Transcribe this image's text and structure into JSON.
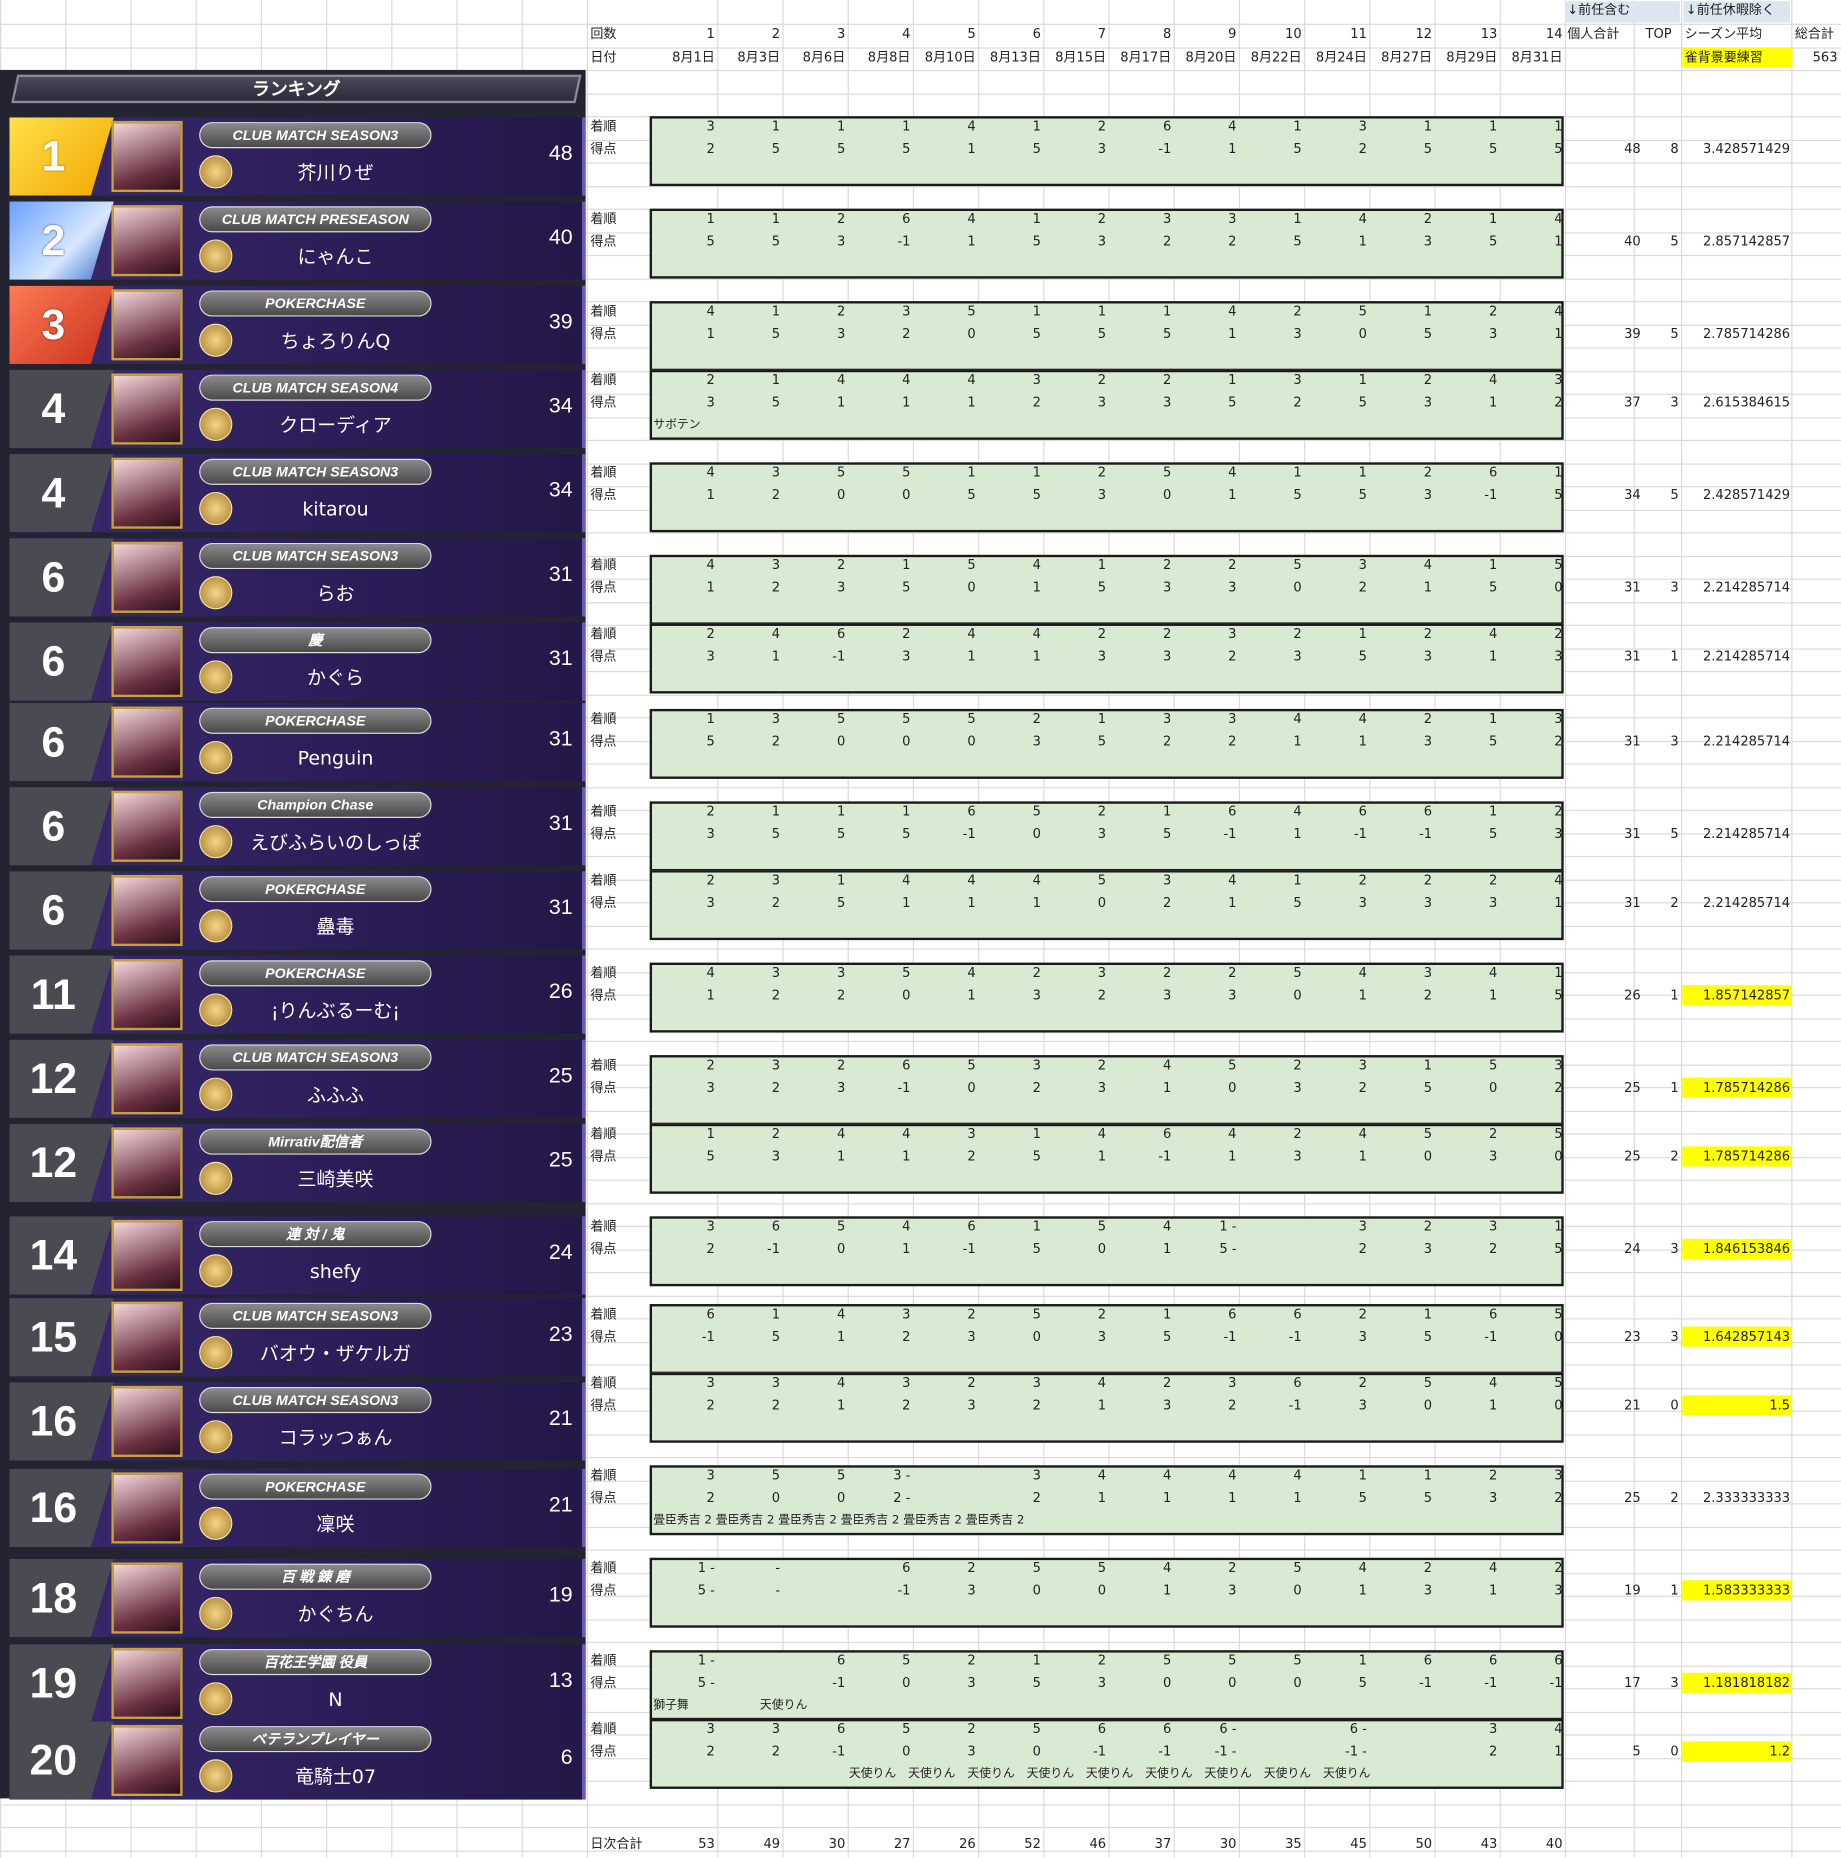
{
  "header": {
    "row1_label": "回数",
    "row2_label": "日付",
    "rounds": [
      "1",
      "2",
      "3",
      "4",
      "5",
      "6",
      "7",
      "8",
      "9",
      "10",
      "11",
      "12",
      "13",
      "14"
    ],
    "dates": [
      "8月1日",
      "8月3日",
      "8月6日",
      "8月8日",
      "8月10日",
      "8月13日",
      "8月15日",
      "8月17日",
      "8月20日",
      "8月22日",
      "8月24日",
      "8月27日",
      "8月29日",
      "8月31日"
    ],
    "note_incl": "↓前任含む",
    "note_excl": "↓前任休暇除く",
    "personal_total": "個人合計",
    "top": "TOP",
    "season_avg": "シーズン平均",
    "grand_total_label": "総合計",
    "grand_total_value": "563",
    "warning": "雀背景要練習"
  },
  "ranking_title": "ランキング",
  "row_labels": {
    "rank": "着順",
    "score": "得点"
  },
  "players": [
    {
      "rank": "1",
      "name": "芥川りぜ",
      "badge": "CLUB MATCH SEASON3",
      "points": "48",
      "tier": "g1",
      "ranks": [
        "3",
        "1",
        "1",
        "1",
        "4",
        "1",
        "2",
        "6",
        "4",
        "1",
        "3",
        "1",
        "1",
        "1"
      ],
      "scores": [
        "2",
        "5",
        "5",
        "5",
        "1",
        "5",
        "3",
        "-1",
        "1",
        "5",
        "2",
        "5",
        "5",
        "5"
      ],
      "total": "48",
      "top": "8",
      "avg": "3.428571429",
      "hl": false,
      "note": ""
    },
    {
      "rank": "2",
      "name": "にゃんこ",
      "badge": "CLUB MATCH PRESEASON",
      "points": "40",
      "tier": "g2",
      "ranks": [
        "1",
        "1",
        "2",
        "6",
        "4",
        "1",
        "2",
        "3",
        "3",
        "1",
        "4",
        "2",
        "1",
        "4"
      ],
      "scores": [
        "5",
        "5",
        "3",
        "-1",
        "1",
        "5",
        "3",
        "2",
        "2",
        "5",
        "1",
        "3",
        "5",
        "1"
      ],
      "total": "40",
      "top": "5",
      "avg": "2.857142857",
      "hl": false,
      "note": ""
    },
    {
      "rank": "3",
      "name": "ちょろりんQ",
      "badge": "POKERCHASE",
      "points": "39",
      "tier": "g3",
      "ranks": [
        "4",
        "1",
        "2",
        "3",
        "5",
        "1",
        "1",
        "1",
        "4",
        "2",
        "5",
        "1",
        "2",
        "4"
      ],
      "scores": [
        "1",
        "5",
        "3",
        "2",
        "0",
        "5",
        "5",
        "5",
        "1",
        "3",
        "0",
        "5",
        "3",
        "1"
      ],
      "total": "39",
      "top": "5",
      "avg": "2.785714286",
      "hl": false,
      "note": ""
    },
    {
      "rank": "4",
      "name": "クローディア",
      "badge": "CLUB MATCH SEASON4",
      "points": "34",
      "tier": "",
      "ranks": [
        "2",
        "1",
        "4",
        "4",
        "4",
        "3",
        "2",
        "2",
        "1",
        "3",
        "1",
        "2",
        "4",
        "3"
      ],
      "scores": [
        "3",
        "5",
        "1",
        "1",
        "1",
        "2",
        "3",
        "3",
        "5",
        "2",
        "5",
        "3",
        "1",
        "2"
      ],
      "total": "37",
      "top": "3",
      "avg": "2.615384615",
      "hl": false,
      "note": "サボテン"
    },
    {
      "rank": "4",
      "name": "kitarou",
      "badge": "CLUB MATCH SEASON3",
      "points": "34",
      "tier": "",
      "ranks": [
        "4",
        "3",
        "5",
        "5",
        "1",
        "1",
        "2",
        "5",
        "4",
        "1",
        "1",
        "2",
        "6",
        "1"
      ],
      "scores": [
        "1",
        "2",
        "0",
        "0",
        "5",
        "5",
        "3",
        "0",
        "1",
        "5",
        "5",
        "3",
        "-1",
        "5"
      ],
      "total": "34",
      "top": "5",
      "avg": "2.428571429",
      "hl": false,
      "note": ""
    },
    {
      "rank": "6",
      "name": "らお",
      "badge": "CLUB MATCH SEASON3",
      "points": "31",
      "tier": "",
      "ranks": [
        "4",
        "3",
        "2",
        "1",
        "5",
        "4",
        "1",
        "2",
        "2",
        "5",
        "3",
        "4",
        "1",
        "5"
      ],
      "scores": [
        "1",
        "2",
        "3",
        "5",
        "0",
        "1",
        "5",
        "3",
        "3",
        "0",
        "2",
        "1",
        "5",
        "0"
      ],
      "total": "31",
      "top": "3",
      "avg": "2.214285714",
      "hl": false,
      "note": ""
    },
    {
      "rank": "6",
      "name": "かぐら",
      "badge": "慶",
      "points": "31",
      "tier": "",
      "ranks": [
        "2",
        "4",
        "6",
        "2",
        "4",
        "4",
        "2",
        "2",
        "3",
        "2",
        "1",
        "2",
        "4",
        "2"
      ],
      "scores": [
        "3",
        "1",
        "-1",
        "3",
        "1",
        "1",
        "3",
        "3",
        "2",
        "3",
        "5",
        "3",
        "1",
        "3"
      ],
      "total": "31",
      "top": "1",
      "avg": "2.214285714",
      "hl": false,
      "note": ""
    },
    {
      "rank": "6",
      "name": "Penguin",
      "badge": "POKERCHASE",
      "points": "31",
      "tier": "",
      "ranks": [
        "1",
        "3",
        "5",
        "5",
        "5",
        "2",
        "1",
        "3",
        "3",
        "4",
        "4",
        "2",
        "1",
        "3"
      ],
      "scores": [
        "5",
        "2",
        "0",
        "0",
        "0",
        "3",
        "5",
        "2",
        "2",
        "1",
        "1",
        "3",
        "5",
        "2"
      ],
      "total": "31",
      "top": "3",
      "avg": "2.214285714",
      "hl": false,
      "note": ""
    },
    {
      "rank": "6",
      "name": "えびふらいのしっぽ",
      "badge": "Champion Chase",
      "points": "31",
      "tier": "",
      "ranks": [
        "2",
        "1",
        "1",
        "1",
        "6",
        "5",
        "2",
        "1",
        "6",
        "4",
        "6",
        "6",
        "1",
        "2"
      ],
      "scores": [
        "3",
        "5",
        "5",
        "5",
        "-1",
        "0",
        "3",
        "5",
        "-1",
        "1",
        "-1",
        "-1",
        "5",
        "3"
      ],
      "total": "31",
      "top": "5",
      "avg": "2.214285714",
      "hl": false,
      "note": ""
    },
    {
      "rank": "6",
      "name": "蠱毒",
      "badge": "POKERCHASE",
      "points": "31",
      "tier": "",
      "ranks": [
        "2",
        "3",
        "1",
        "4",
        "4",
        "4",
        "5",
        "3",
        "4",
        "1",
        "2",
        "2",
        "2",
        "4"
      ],
      "scores": [
        "3",
        "2",
        "5",
        "1",
        "1",
        "1",
        "0",
        "2",
        "1",
        "5",
        "3",
        "3",
        "3",
        "1"
      ],
      "total": "31",
      "top": "2",
      "avg": "2.214285714",
      "hl": false,
      "note": ""
    },
    {
      "rank": "11",
      "name": "¡りんぶるーむ¡",
      "badge": "POKERCHASE",
      "points": "26",
      "tier": "",
      "ranks": [
        "4",
        "3",
        "3",
        "5",
        "4",
        "2",
        "3",
        "2",
        "2",
        "5",
        "4",
        "3",
        "4",
        "1"
      ],
      "scores": [
        "1",
        "2",
        "2",
        "0",
        "1",
        "3",
        "2",
        "3",
        "3",
        "0",
        "1",
        "2",
        "1",
        "5"
      ],
      "total": "26",
      "top": "1",
      "avg": "1.857142857",
      "hl": true,
      "note": ""
    },
    {
      "rank": "12",
      "name": "ふふふ",
      "badge": "CLUB MATCH SEASON3",
      "points": "25",
      "tier": "",
      "ranks": [
        "2",
        "3",
        "2",
        "6",
        "5",
        "3",
        "2",
        "4",
        "5",
        "2",
        "3",
        "1",
        "5",
        "3"
      ],
      "scores": [
        "3",
        "2",
        "3",
        "-1",
        "0",
        "2",
        "3",
        "1",
        "0",
        "3",
        "2",
        "5",
        "0",
        "2"
      ],
      "total": "25",
      "top": "1",
      "avg": "1.785714286",
      "hl": true,
      "note": ""
    },
    {
      "rank": "12",
      "name": "三崎美咲",
      "badge": "Mirrativ配信者",
      "points": "25",
      "tier": "",
      "ranks": [
        "1",
        "2",
        "4",
        "4",
        "3",
        "1",
        "4",
        "6",
        "4",
        "2",
        "4",
        "5",
        "2",
        "5"
      ],
      "scores": [
        "5",
        "3",
        "1",
        "1",
        "2",
        "5",
        "1",
        "-1",
        "1",
        "3",
        "1",
        "0",
        "3",
        "0"
      ],
      "total": "25",
      "top": "2",
      "avg": "1.785714286",
      "hl": true,
      "note": ""
    },
    {
      "rank": "14",
      "name": "shefy",
      "badge": "連 対 / 鬼",
      "points": "24",
      "tier": "",
      "ranks": [
        "3",
        "6",
        "5",
        "4",
        "6",
        "1",
        "5",
        "4",
        "1 -",
        "",
        "3",
        "2",
        "3",
        "1"
      ],
      "scores": [
        "2",
        "-1",
        "0",
        "1",
        "-1",
        "5",
        "0",
        "1",
        "5 -",
        "",
        "2",
        "3",
        "2",
        "5"
      ],
      "total": "24",
      "top": "3",
      "avg": "1.846153846",
      "hl": true,
      "note": ""
    },
    {
      "rank": "15",
      "name": "バオウ・ザケルガ",
      "badge": "CLUB MATCH SEASON3",
      "points": "23",
      "tier": "",
      "ranks": [
        "6",
        "1",
        "4",
        "3",
        "2",
        "5",
        "2",
        "1",
        "6",
        "6",
        "2",
        "1",
        "6",
        "5"
      ],
      "scores": [
        "-1",
        "5",
        "1",
        "2",
        "3",
        "0",
        "3",
        "5",
        "-1",
        "-1",
        "3",
        "5",
        "-1",
        "0"
      ],
      "total": "23",
      "top": "3",
      "avg": "1.642857143",
      "hl": true,
      "note": ""
    },
    {
      "rank": "16",
      "name": "コラッつぁん",
      "badge": "CLUB MATCH SEASON3",
      "points": "21",
      "tier": "",
      "ranks": [
        "3",
        "3",
        "4",
        "3",
        "2",
        "3",
        "4",
        "2",
        "3",
        "6",
        "2",
        "5",
        "4",
        "5"
      ],
      "scores": [
        "2",
        "2",
        "1",
        "2",
        "3",
        "2",
        "1",
        "3",
        "2",
        "-1",
        "3",
        "0",
        "1",
        "0"
      ],
      "total": "21",
      "top": "0",
      "avg": "1.5",
      "hl": true,
      "note": ""
    },
    {
      "rank": "16",
      "name": "凜咲",
      "badge": "POKERCHASE",
      "points": "21",
      "tier": "",
      "ranks": [
        "3",
        "5",
        "5",
        "3 -",
        "",
        "3",
        "4",
        "4",
        "4",
        "4",
        "1",
        "1",
        "2",
        "3"
      ],
      "scores": [
        "2",
        "0",
        "0",
        "2 -",
        "",
        "2",
        "1",
        "1",
        "1",
        "1",
        "5",
        "5",
        "3",
        "2"
      ],
      "total": "25",
      "top": "2",
      "avg": "2.333333333",
      "hl": false,
      "note": "畳臣秀吉 2 畳臣秀吉 2 畳臣秀吉 2 畳臣秀吉 2 畳臣秀吉 2 畳臣秀吉 2"
    },
    {
      "rank": "18",
      "name": "かぐちん",
      "badge": "百 戦 錬 磨",
      "points": "19",
      "tier": "",
      "ranks": [
        "1 -",
        "-",
        "",
        "6",
        "2",
        "5",
        "5",
        "4",
        "2",
        "5",
        "4",
        "2",
        "4",
        "2"
      ],
      "scores": [
        "5 -",
        "-",
        "",
        "-1",
        "3",
        "0",
        "0",
        "1",
        "3",
        "0",
        "1",
        "3",
        "1",
        "3"
      ],
      "total": "19",
      "top": "1",
      "avg": "1.583333333",
      "hl": true,
      "note": ""
    },
    {
      "rank": "19",
      "name": "N",
      "badge": "百花王学園 役員",
      "points": "13",
      "tier": "",
      "ranks": [
        "1 -",
        "",
        "6",
        "5",
        "2",
        "1",
        "2",
        "5",
        "5",
        "5",
        "1",
        "6",
        "6",
        "6"
      ],
      "scores": [
        "5 -",
        "",
        "-1",
        "0",
        "3",
        "5",
        "3",
        "0",
        "0",
        "0",
        "5",
        "-1",
        "-1",
        "-1"
      ],
      "total": "17",
      "top": "3",
      "avg": "1.181818182",
      "hl": true,
      "note": "獅子舞　　　　　　天使りん"
    },
    {
      "rank": "20",
      "name": "竜騎士07",
      "badge": "ベテランプレイヤー",
      "points": "6",
      "tier": "",
      "ranks": [
        "3",
        "3",
        "6",
        "5",
        "2",
        "5",
        "6",
        "6",
        "6 -",
        "",
        "6 -",
        "",
        "3",
        "4"
      ],
      "scores": [
        "2",
        "2",
        "-1",
        "0",
        "3",
        "0",
        "-1",
        "-1",
        "-1 -",
        "",
        "-1 -",
        "",
        "2",
        "1"
      ],
      "total": "5",
      "top": "0",
      "avg": "1.2",
      "hl": true,
      "note": "天使りん　天使りん　天使りん　天使りん　天使りん　天使りん　天使りん　天使りん　天使りん"
    }
  ],
  "daily_total_label": "日次合計",
  "daily_totals": [
    "53",
    "49",
    "30",
    "27",
    "26",
    "52",
    "46",
    "37",
    "30",
    "35",
    "45",
    "50",
    "43",
    "40"
  ]
}
